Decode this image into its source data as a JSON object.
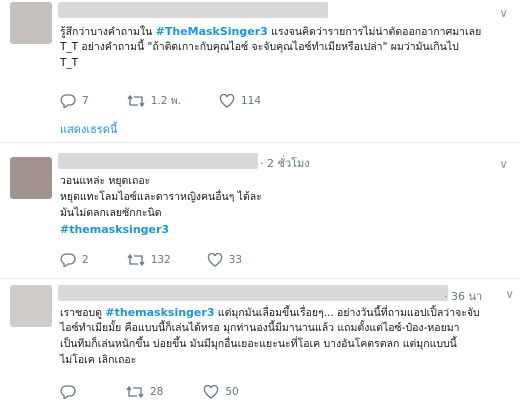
{
  "tweets": [
    {
      "time": "",
      "lines_pre": "รู้สึกว่าบางคำถามใน ",
      "hashtag_inline": "#TheMaskSinger3",
      "line1_post": " แรงจนคิดว่ารายการไม่น่าตัดออกอากาศมาเลย",
      "line2": "T_T อย่างคำถามนี้ \"ถ้าติดเกาะกับคุณไอซ์ จะจับคุณไอซ์ทำเมียหรือเปล่า\" ผมว่ามันเกินไป",
      "line3": "T_T",
      "reply": "7",
      "retweet": "1.2 พ.",
      "like": "114",
      "thread": "แสดงเธรดนี้"
    },
    {
      "time": "· 2 ชั่วโมง",
      "line1": "วอนแหล่ะ หยุดเถอะ",
      "line2": "หยุดแทะโลมไอซ์และดาราหญิงคนอื่นๆ ได้ละ",
      "line3": "มันไม่ตลกเลยซักกะนิด",
      "hashtag": "#themasksinger3",
      "reply": "2",
      "retweet": "132",
      "like": "33"
    },
    {
      "time": "· 36 นา",
      "line1_pre": "เราชอบดู ",
      "hashtag_inline": "#themasksinger3",
      "line1_post": " แต่มุกมันเลื่อมขึ้นเรื่อยๆ... อย่างวันนี้ที่ถามแอปเปิ้ลว่าจะจับ",
      "line2": "ไอซ์ทำเมียมั้ย คือแบบนี้ก็เล่นได้หรอ มุกท่านองนี้มีมานานแล้ว แถมตั้งแต่ไอซ์-ป๋อง-หอยมา",
      "line3": "เป็นทีมก็เล่นหนักขึ้น บ่อยขึ้น มันมีมุกอื่นเยอะแยะนะที่โอเค บางอันโคตรตลก แต่มุกแบบนี้",
      "line4": "ไม่โอเค เลิกเถอะ",
      "reply": "",
      "retweet": "28",
      "like": "50"
    }
  ]
}
